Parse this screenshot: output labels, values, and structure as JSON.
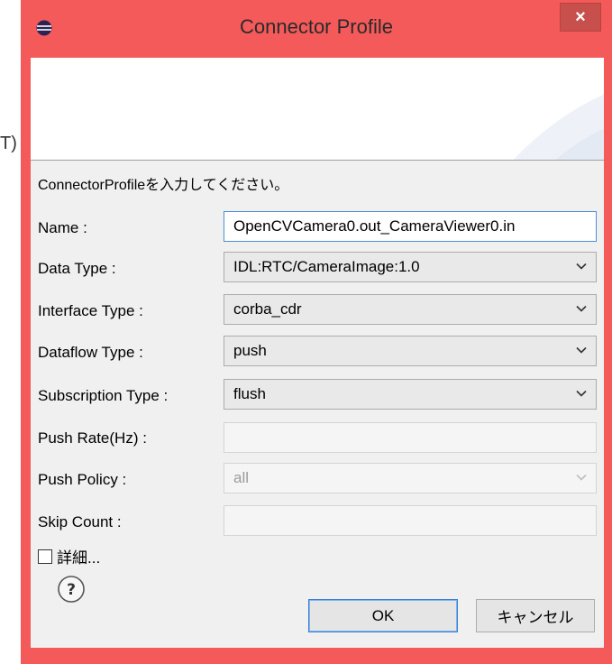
{
  "background": {
    "text": "T)"
  },
  "window": {
    "title": "Connector Profile",
    "close_glyph": "×",
    "frame_color": "#f55a5a",
    "icon": "eclipse-icon"
  },
  "form": {
    "prompt": "ConnectorProfileを入力してください。",
    "fields": [
      {
        "label": "Name :",
        "value": "OpenCVCamera0.out_CameraViewer0.in",
        "kind": "input"
      },
      {
        "label": "Data Type :",
        "value": "IDL:RTC/CameraImage:1.0",
        "kind": "select"
      },
      {
        "label": "Interface Type :",
        "value": "corba_cdr",
        "kind": "select"
      },
      {
        "label": "Dataflow Type :",
        "value": "push",
        "kind": "select"
      },
      {
        "label": "Subscription Type :",
        "value": "flush",
        "kind": "select"
      },
      {
        "label": "Push Rate(Hz) :",
        "value": "",
        "kind": "disabled-input"
      },
      {
        "label": "Push Policy :",
        "value": "all",
        "kind": "disabled-select"
      },
      {
        "label": "Skip Count :",
        "value": "",
        "kind": "disabled-input"
      }
    ],
    "detail_checkbox": {
      "label": "詳細...",
      "checked": false
    }
  },
  "buttons": {
    "help_icon": "help-icon",
    "ok": "OK",
    "cancel": "キャンセル"
  }
}
